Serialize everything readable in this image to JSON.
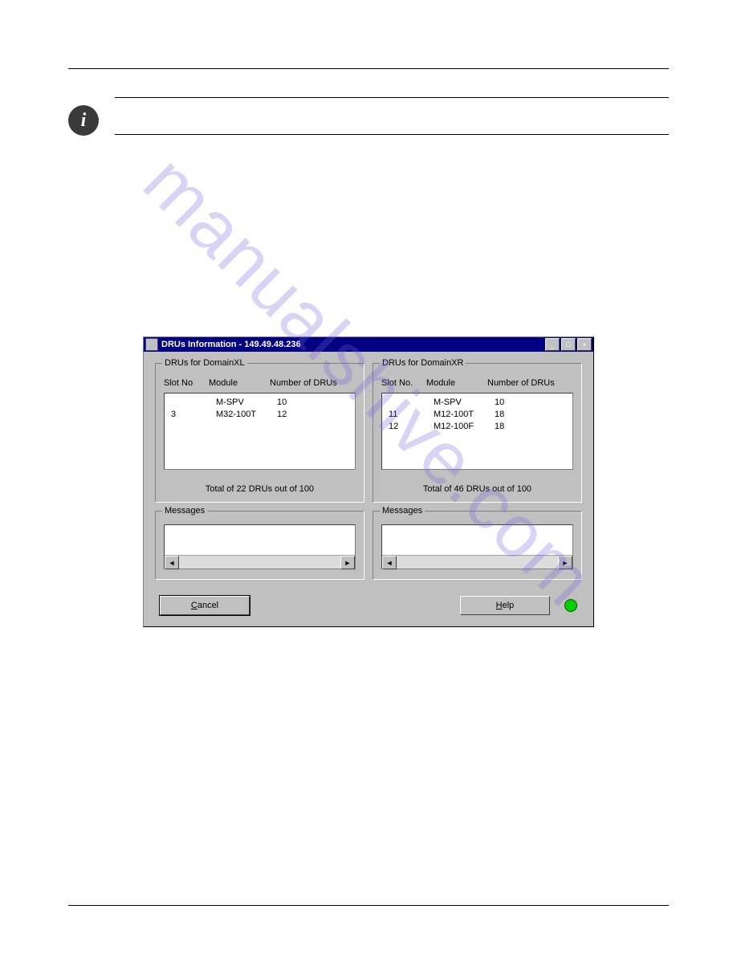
{
  "watermark": "manualshive.com",
  "dialog": {
    "title": "DRUs Information - 149.49.48.236",
    "left": {
      "group_title": "DRUs for DomainXL",
      "headers": {
        "slot": "Slot No",
        "module": "Module",
        "number": "Number of DRUs"
      },
      "rows": [
        {
          "slot": "",
          "module": "M-SPV",
          "number": "10"
        },
        {
          "slot": "3",
          "module": "M32-100T",
          "number": "12"
        }
      ],
      "total": "Total of 22 DRUs out of 100"
    },
    "right": {
      "group_title": "DRUs for DomainXR",
      "headers": {
        "slot": "Slot No.",
        "module": "Module",
        "number": "Number of DRUs"
      },
      "rows": [
        {
          "slot": "",
          "module": "M-SPV",
          "number": "10"
        },
        {
          "slot": "11",
          "module": "M12-100T",
          "number": "18"
        },
        {
          "slot": "12",
          "module": "M12-100F",
          "number": "18"
        }
      ],
      "total": "Total of 46 DRUs out of 100"
    },
    "messages_label": "Messages",
    "cancel": "Cancel",
    "help": "Help"
  },
  "chart_data": {
    "type": "table",
    "title": "DRUs Information - 149.49.48.236",
    "tables": [
      {
        "name": "DRUs for DomainXL",
        "columns": [
          "Slot No",
          "Module",
          "Number of DRUs"
        ],
        "rows": [
          [
            "",
            "M-SPV",
            10
          ],
          [
            "3",
            "M32-100T",
            12
          ]
        ],
        "total_drus": 22,
        "max_drus": 100
      },
      {
        "name": "DRUs for DomainXR",
        "columns": [
          "Slot No.",
          "Module",
          "Number of DRUs"
        ],
        "rows": [
          [
            "",
            "M-SPV",
            10
          ],
          [
            "11",
            "M12-100T",
            18
          ],
          [
            "12",
            "M12-100F",
            18
          ]
        ],
        "total_drus": 46,
        "max_drus": 100
      }
    ]
  }
}
